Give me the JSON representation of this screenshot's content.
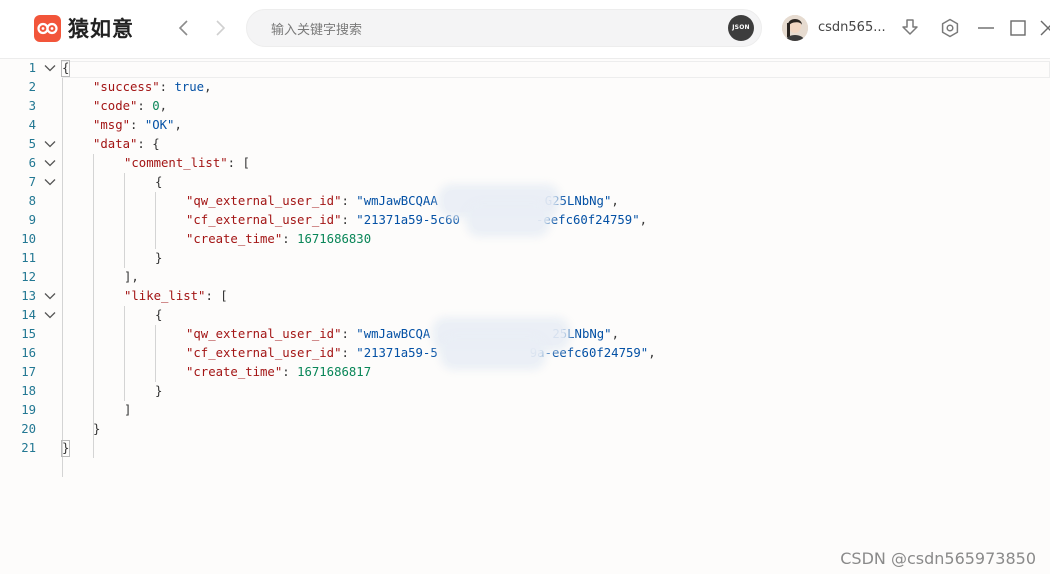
{
  "app": {
    "name": "猿如意"
  },
  "search": {
    "placeholder": "输入关键字搜索",
    "json_badge": "JSON"
  },
  "user": {
    "name": "csdn565..."
  },
  "colors": {
    "brand": "#f2553a",
    "key": "#a31515",
    "string": "#0451a5",
    "number": "#098658",
    "line_number": "#237893"
  },
  "icons": {
    "back": "chevron-left-icon",
    "forward": "chevron-right-icon",
    "download": "download-icon",
    "settings": "settings-icon",
    "minimize": "minimize-icon",
    "maximize": "maximize-icon",
    "close": "close-icon"
  },
  "editor": {
    "line_numbers": [
      "1",
      "2",
      "3",
      "4",
      "5",
      "6",
      "7",
      "8",
      "9",
      "10",
      "11",
      "12",
      "13",
      "14",
      "15",
      "16",
      "17",
      "18",
      "19",
      "20",
      "21"
    ],
    "tokens": {
      "l1_open": "{",
      "success_key": "\"success\"",
      "success_val": "true",
      "code_key": "\"code\"",
      "code_val": "0",
      "msg_key": "\"msg\"",
      "msg_val": "\"OK\"",
      "data_key": "\"data\"",
      "comment_list_key": "\"comment_list\"",
      "qw_key": "\"qw_external_user_id\"",
      "cf_key": "\"cf_external_user_id\"",
      "create_time_key": "\"create_time\"",
      "c_qw_val_a": "\"wmJawBCQAA",
      "c_qw_val_b": "G25LNbNg\"",
      "c_cf_val_a": "\"21371a59-5c60",
      "c_cf_val_b": "-eefc60f24759\"",
      "c_time_val": "1671686830",
      "like_list_key": "\"like_list\"",
      "l_qw_val_a": "\"wmJawBCQA",
      "l_qw_val_b": "25LNbNg\"",
      "l_cf_val_a": "\"21371a59-5",
      "l_cf_val_b": "9a-eefc60f24759\"",
      "l_time_val": "1671686817"
    }
  },
  "watermark": "CSDN @csdn565973850"
}
